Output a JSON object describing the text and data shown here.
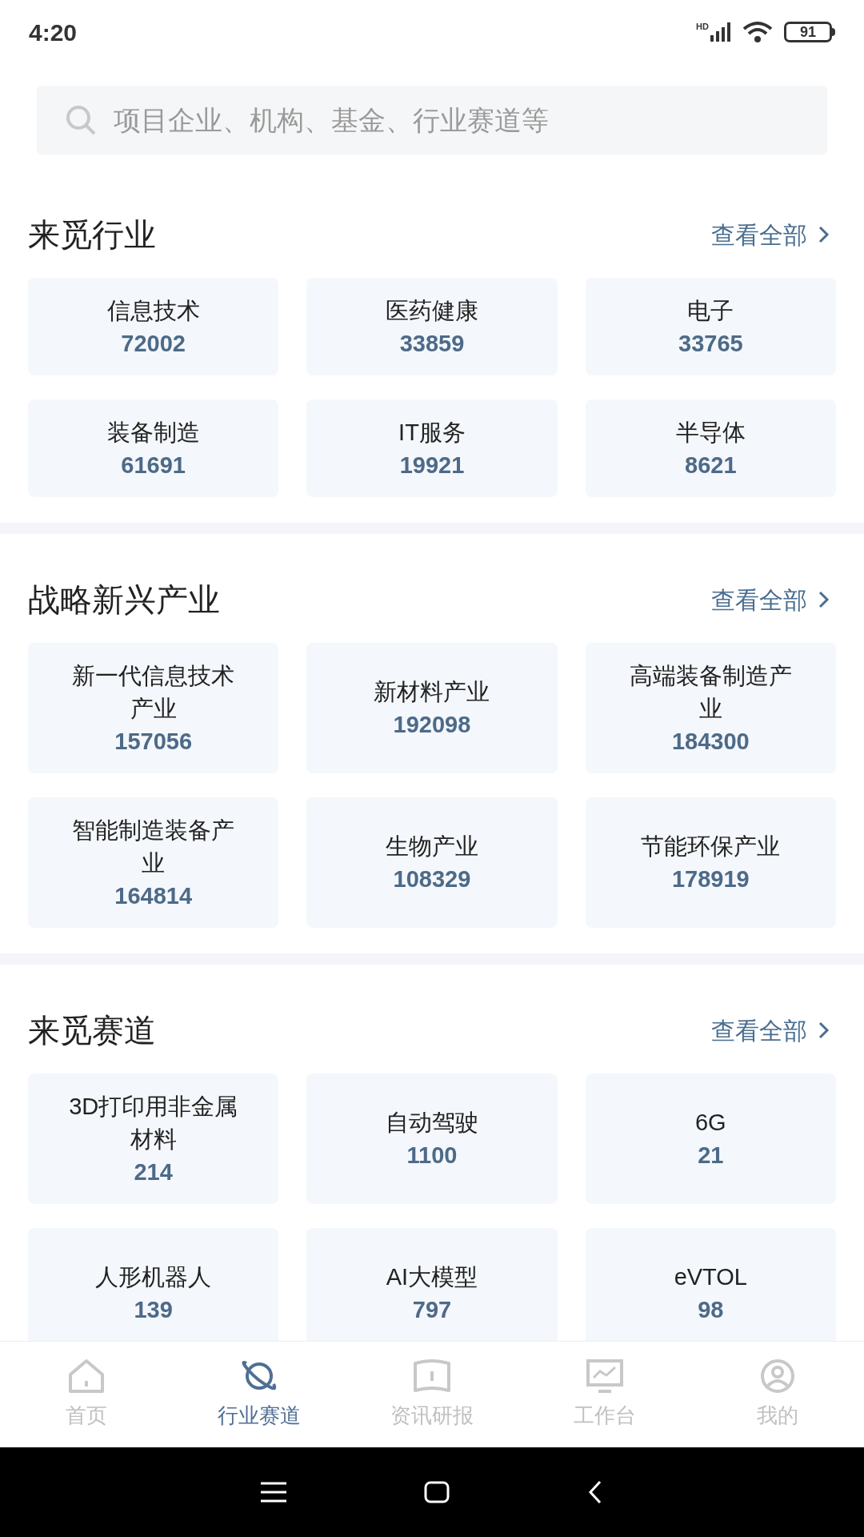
{
  "status_bar": {
    "time": "4:20",
    "network": "HD",
    "battery": "91"
  },
  "search": {
    "placeholder": "项目企业、机构、基金、行业赛道等"
  },
  "sections": [
    {
      "title": "来觅行业",
      "more": "查看全部",
      "items": [
        {
          "label": "信息技术",
          "count": "72002"
        },
        {
          "label": "医药健康",
          "count": "33859"
        },
        {
          "label": "电子",
          "count": "33765"
        },
        {
          "label": "装备制造",
          "count": "61691"
        },
        {
          "label": "IT服务",
          "count": "19921"
        },
        {
          "label": "半导体",
          "count": "8621"
        }
      ]
    },
    {
      "title": "战略新兴产业",
      "more": "查看全部",
      "items": [
        {
          "label": "新一代信息技术产业",
          "count": "157056"
        },
        {
          "label": "新材料产业",
          "count": "192098"
        },
        {
          "label": "高端装备制造产业",
          "count": "184300"
        },
        {
          "label": "智能制造装备产业",
          "count": "164814"
        },
        {
          "label": "生物产业",
          "count": "108329"
        },
        {
          "label": "节能环保产业",
          "count": "178919"
        }
      ]
    },
    {
      "title": "来觅赛道",
      "more": "查看全部",
      "items": [
        {
          "label": "3D打印用非金属材料",
          "count": "214"
        },
        {
          "label": "自动驾驶",
          "count": "1100"
        },
        {
          "label": "6G",
          "count": "21"
        },
        {
          "label": "人形机器人",
          "count": "139"
        },
        {
          "label": "AI大模型",
          "count": "797"
        },
        {
          "label": "eVTOL",
          "count": "98"
        }
      ]
    }
  ],
  "tab_bar": [
    {
      "label": "首页",
      "kind": "home",
      "selected": false
    },
    {
      "label": "行业赛道",
      "kind": "planet",
      "selected": true
    },
    {
      "label": "资讯研报",
      "kind": "book",
      "selected": false
    },
    {
      "label": "工作台",
      "kind": "monitor",
      "selected": false
    },
    {
      "label": "我的",
      "kind": "user",
      "selected": false
    }
  ]
}
